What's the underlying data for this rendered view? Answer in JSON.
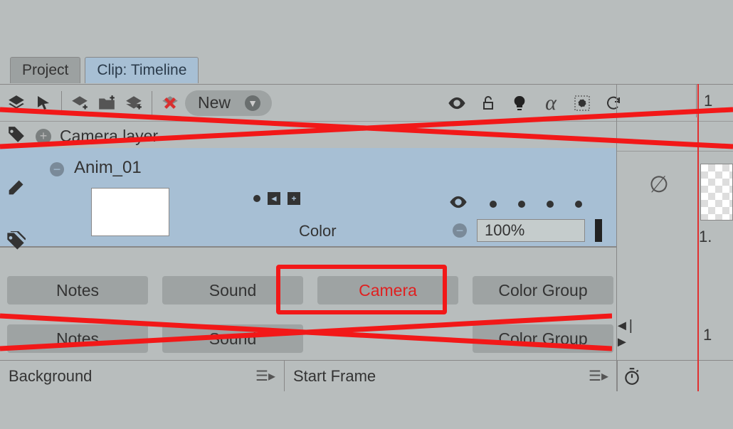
{
  "tabs": {
    "project": "Project",
    "clip": "Clip: Timeline"
  },
  "toolbar": {
    "new_label": "New"
  },
  "header_frame": "1",
  "camera_layer": {
    "label": "Camera layer"
  },
  "layer": {
    "name": "Anim_01",
    "color_label": "Color",
    "opacity": "100%"
  },
  "buttons": {
    "notes": "Notes",
    "sound": "Sound",
    "camera": "Camera",
    "color_group": "Color Group"
  },
  "bottom": {
    "background": "Background",
    "start_frame": "Start Frame"
  },
  "timeline": {
    "frame_b": "1.",
    "frame_c": "1"
  }
}
